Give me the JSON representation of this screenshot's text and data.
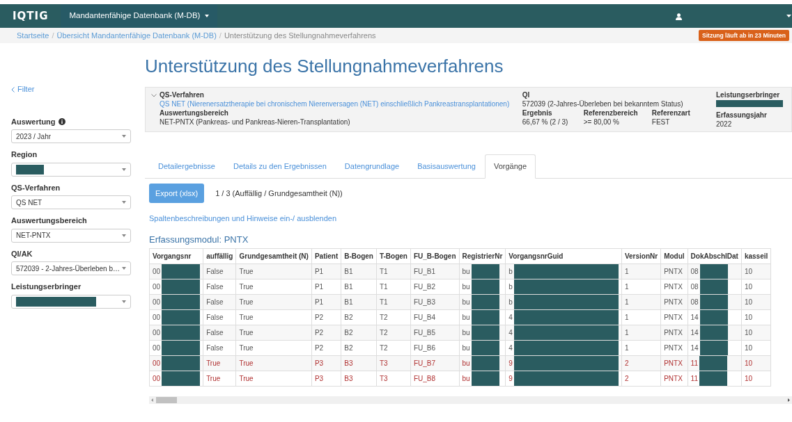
{
  "navbar": {
    "brand": "IQTIG",
    "menu": "Mandantenfähige Datenbank (M-DB)"
  },
  "breadcrumb_separator": "/",
  "breadcrumb": [
    {
      "label": "Startseite",
      "link": true
    },
    {
      "label": "Übersicht Mandantenfähige Datenbank (M-DB)",
      "link": true
    },
    {
      "label": "Unterstützung des Stellungnahmeverfahrens",
      "link": false
    }
  ],
  "session_badge": "Sitzung läuft ab in 23 Minuten",
  "title": "Unterstützung des Stellungnahmeverfahrens",
  "sidebar": {
    "back": "Filter",
    "filters": [
      {
        "label": "Auswertung",
        "info": true,
        "value": "2023 / Jahr",
        "redacted": false
      },
      {
        "label": "Region",
        "info": false,
        "redacted": true
      },
      {
        "label": "QS-Verfahren",
        "info": false,
        "value": "QS NET",
        "redacted": false
      },
      {
        "label": "Auswertungsbereich",
        "info": false,
        "value": "NET-PNTX",
        "redacted": false
      },
      {
        "label": "QI/AK",
        "info": false,
        "value": "572039 - 2-Jahres-Überleben b…",
        "redacted": false
      },
      {
        "label": "Leistungserbringer",
        "info": false,
        "redacted": true
      }
    ]
  },
  "summary": {
    "expanded": true,
    "qs_verfahren": {
      "label": "QS-Verfahren",
      "value": "QS NET (Nierenersatztherapie bei chronischem Nierenversagen (NET) einschließlich Pankreastransplantationen)"
    },
    "auswertungsbereich": {
      "label": "Auswertungsbereich",
      "value": "NET-PNTX (Pankreas- und Pankreas-Nieren-Transplantation)"
    },
    "qi": {
      "label": "QI",
      "value": "572039 (2-Jahres-Überleben bei bekanntem Status)"
    },
    "ergebnis": {
      "label": "Ergebnis",
      "value": "66,67 % (2 / 3)"
    },
    "referenzbereich": {
      "label": "Referenzbereich",
      "value": ">= 80,00 %"
    },
    "referenzart": {
      "label": "Referenzart",
      "value": "FEST"
    },
    "leistungserbringer": {
      "label": "Leistungserbringer",
      "redacted": true
    },
    "erfassungsjahr": {
      "label": "Erfassungsjahr",
      "value": "2022"
    }
  },
  "tabs": [
    {
      "label": "Detailergebnisse",
      "selected": false
    },
    {
      "label": "Details zu den Ergebnissen",
      "selected": false
    },
    {
      "label": "Datengrundlage",
      "selected": false
    },
    {
      "label": "Basisauswertung",
      "selected": false
    },
    {
      "label": "Vorgänge",
      "selected": true
    }
  ],
  "export_button": "Export (xlsx)",
  "count_text": "1 / 3 (Auffällig / Grundgesamtheit (N))",
  "toggle_link": "Spaltenbeschreibungen und Hinweise ein-/ ausblenden",
  "module_heading": "Erfassungsmodul: PNTX",
  "table": {
    "columns": [
      {
        "label": "Vorgangsnr",
        "redacted": true
      },
      {
        "label": "auffällig",
        "redacted": false
      },
      {
        "label": "Grundgesamtheit (N)",
        "redacted": false
      },
      {
        "label": "Patient",
        "redacted": false
      },
      {
        "label": "B-Bogen",
        "redacted": false
      },
      {
        "label": "T-Bogen",
        "redacted": false
      },
      {
        "label": "FU_B-Bogen",
        "redacted": false
      },
      {
        "label": "RegistrierNr",
        "redacted": true
      },
      {
        "label": "VorgangsnrGuid",
        "redacted": true
      },
      {
        "label": "VersionNr",
        "redacted": false
      },
      {
        "label": "Modul",
        "redacted": false
      },
      {
        "label": "DokAbschlDat",
        "redacted": true
      },
      {
        "label": "kasseil",
        "redacted": false
      }
    ],
    "rows": [
      {
        "flagged": false,
        "cells": [
          "00",
          "False",
          "True",
          "P1",
          "B1",
          "T1",
          "FU_B1",
          "bu",
          "b",
          "1",
          "PNTX",
          "08",
          "10"
        ]
      },
      {
        "flagged": false,
        "cells": [
          "00",
          "False",
          "True",
          "P1",
          "B1",
          "T1",
          "FU_B2",
          "bu",
          "b",
          "1",
          "PNTX",
          "08",
          "10"
        ]
      },
      {
        "flagged": false,
        "cells": [
          "00",
          "False",
          "True",
          "P1",
          "B1",
          "T1",
          "FU_B3",
          "bu",
          "b",
          "1",
          "PNTX",
          "08",
          "10"
        ]
      },
      {
        "flagged": false,
        "cells": [
          "00",
          "False",
          "True",
          "P2",
          "B2",
          "T2",
          "FU_B4",
          "bu",
          "4",
          "1",
          "PNTX",
          "14",
          "10"
        ]
      },
      {
        "flagged": false,
        "cells": [
          "00",
          "False",
          "True",
          "P2",
          "B2",
          "T2",
          "FU_B5",
          "bu",
          "4",
          "1",
          "PNTX",
          "14",
          "10"
        ]
      },
      {
        "flagged": false,
        "cells": [
          "00",
          "False",
          "True",
          "P2",
          "B2",
          "T2",
          "FU_B6",
          "bu",
          "4",
          "1",
          "PNTX",
          "14",
          "10"
        ]
      },
      {
        "flagged": true,
        "cells": [
          "00",
          "True",
          "True",
          "P3",
          "B3",
          "T3",
          "FU_B7",
          "bu",
          "9",
          "2",
          "PNTX",
          "11",
          "10"
        ]
      },
      {
        "flagged": true,
        "cells": [
          "00",
          "True",
          "True",
          "P3",
          "B3",
          "T3",
          "FU_B8",
          "bu",
          "9",
          "2",
          "PNTX",
          "11",
          "10"
        ]
      }
    ]
  }
}
